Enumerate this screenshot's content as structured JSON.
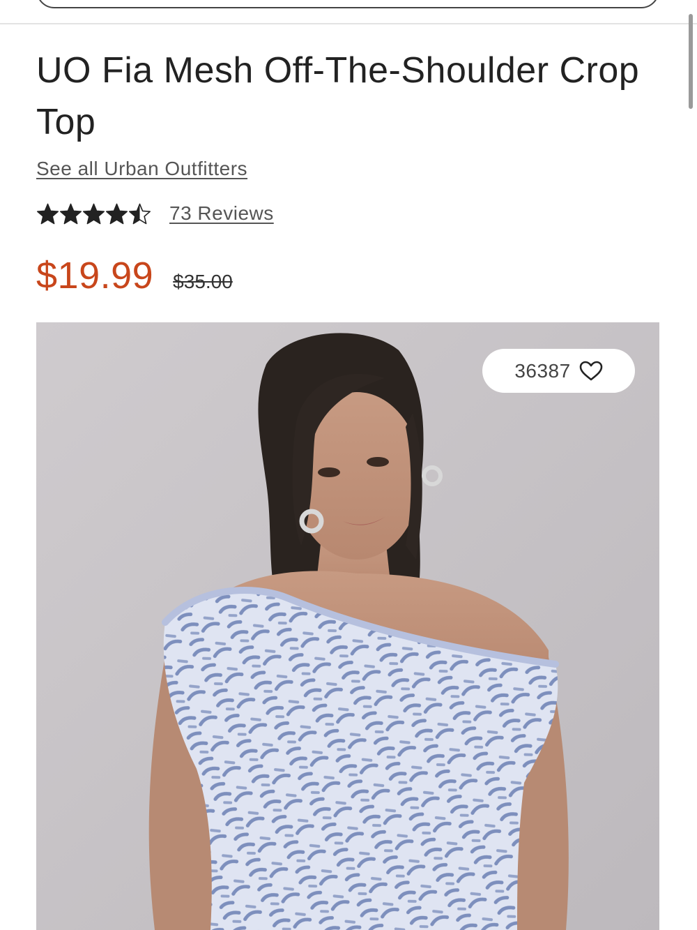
{
  "product": {
    "title": "UO Fia Mesh Off-The-Shoulder Crop Top",
    "brand_link": "See all Urban Outfitters",
    "rating": 4.5,
    "rating_max": 5,
    "reviews_link": "73 Reviews",
    "sale_price": "$19.99",
    "original_price": "$35.00"
  },
  "image": {
    "alt": "",
    "like_count": "36387",
    "heart_icon": "heart-outline-icon"
  },
  "colors": {
    "sale_price": "#c8461b",
    "text": "#222222",
    "link": "#555555",
    "star": "#222222"
  }
}
